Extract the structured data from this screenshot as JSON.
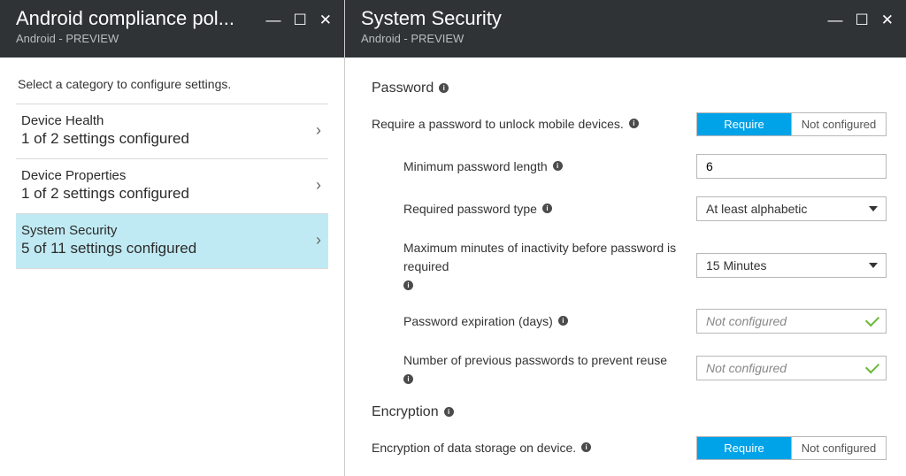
{
  "left": {
    "title": "Android compliance pol...",
    "subtitle": "Android - PREVIEW",
    "prompt": "Select a category to configure settings.",
    "categories": [
      {
        "name": "Device Health",
        "status": "1 of 2 settings configured",
        "selected": false
      },
      {
        "name": "Device Properties",
        "status": "1 of 2 settings configured",
        "selected": false
      },
      {
        "name": "System Security",
        "status": "5 of 11 settings configured",
        "selected": true
      }
    ]
  },
  "right": {
    "title": "System Security",
    "subtitle": "Android - PREVIEW",
    "sections": {
      "password": {
        "heading": "Password",
        "rows": {
          "require": {
            "label": "Require a password to unlock mobile devices.",
            "optA": "Require",
            "optB": "Not configured",
            "active": "A"
          },
          "minlen": {
            "label": "Minimum password length",
            "value": "6"
          },
          "type": {
            "label": "Required password type",
            "value": "At least alphabetic"
          },
          "maxidle": {
            "label": "Maximum minutes of inactivity before password is required",
            "value": "15 Minutes"
          },
          "expire": {
            "label": "Password expiration (days)",
            "value": "Not configured"
          },
          "reuse": {
            "label": "Number of previous passwords to prevent reuse",
            "value": "Not configured"
          }
        }
      },
      "encryption": {
        "heading": "Encryption",
        "rows": {
          "storage": {
            "label": "Encryption of data storage on device.",
            "optA": "Require",
            "optB": "Not configured",
            "active": "A"
          }
        }
      }
    }
  }
}
